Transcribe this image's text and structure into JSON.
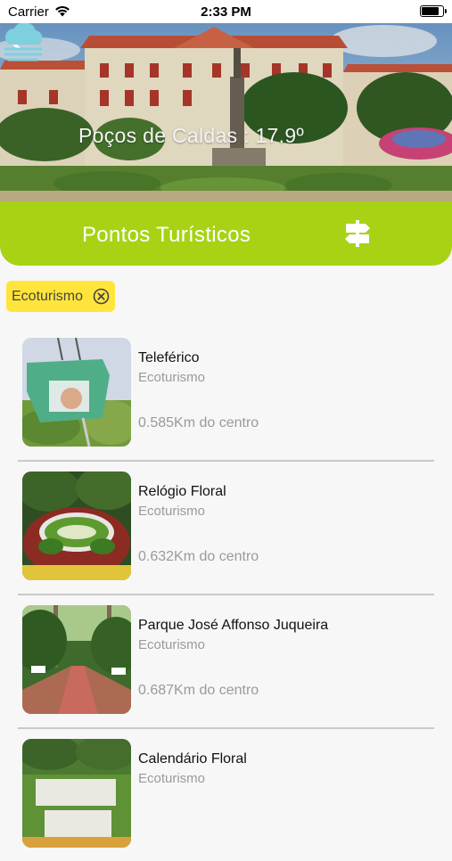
{
  "status_bar": {
    "carrier": "Carrier",
    "time": "2:33 PM"
  },
  "header": {
    "weather_text": "Poços de Caldas : 17.9º",
    "weather_icon": "cloud-rain-icon",
    "back_icon": "chevron-left-icon"
  },
  "section": {
    "title": "Pontos Turísticos",
    "icon": "signpost-icon"
  },
  "filter": {
    "label": "Ecoturismo",
    "icon": "close-circle-icon",
    "color": "#ffe53b"
  },
  "colors": {
    "accent": "#a7d314",
    "chip": "#ffe53b",
    "muted_text": "#9a9a9a"
  },
  "items": [
    {
      "name": "Teleférico",
      "category": "Ecoturismo",
      "distance": "0.585Km do centro"
    },
    {
      "name": "Relógio Floral",
      "category": "Ecoturismo",
      "distance": "0.632Km do centro"
    },
    {
      "name": "Parque José Affonso Juqueira",
      "category": "Ecoturismo",
      "distance": "0.687Km do centro"
    },
    {
      "name": "Calendário Floral",
      "category": "Ecoturismo",
      "distance": ""
    }
  ]
}
